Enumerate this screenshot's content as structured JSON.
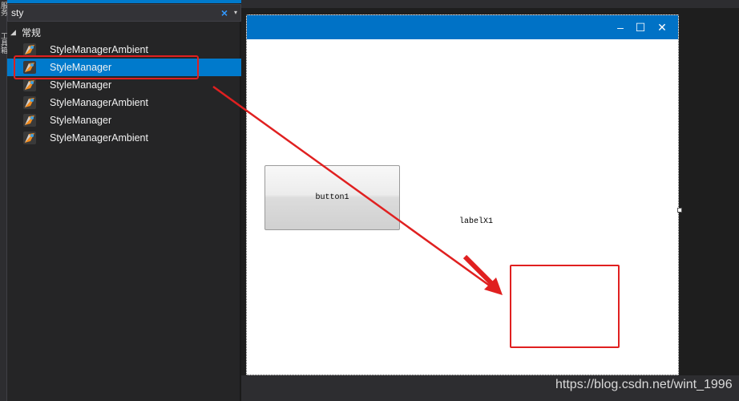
{
  "side_strip": {
    "tabs": [
      "服务",
      "工具箱"
    ]
  },
  "toolbox": {
    "search": {
      "value": "sty",
      "clear_glyph": "×",
      "dropdown_glyph": "▾"
    },
    "group": {
      "caret": "◢",
      "label": "常规"
    },
    "items": [
      {
        "label": "StyleManagerAmbient",
        "icon": "style-manager-icon",
        "selected": false
      },
      {
        "label": "StyleManager",
        "icon": "style-manager-icon",
        "selected": true
      },
      {
        "label": "StyleManager",
        "icon": "style-manager-icon",
        "selected": false
      },
      {
        "label": "StyleManagerAmbient",
        "icon": "style-manager-icon",
        "selected": false
      },
      {
        "label": "StyleManager",
        "icon": "style-manager-icon",
        "selected": false
      },
      {
        "label": "StyleManagerAmbient",
        "icon": "style-manager-icon",
        "selected": false
      }
    ]
  },
  "form": {
    "controls": {
      "minimize": "–",
      "maximize": "☐",
      "close": "✕"
    },
    "button1_label": "button1",
    "label1_text": "labelX1"
  },
  "colors": {
    "accent": "#007acc",
    "titlebar": "#0072c6",
    "annotation": "#e02020"
  },
  "watermark": "https://blog.csdn.net/wint_1996"
}
